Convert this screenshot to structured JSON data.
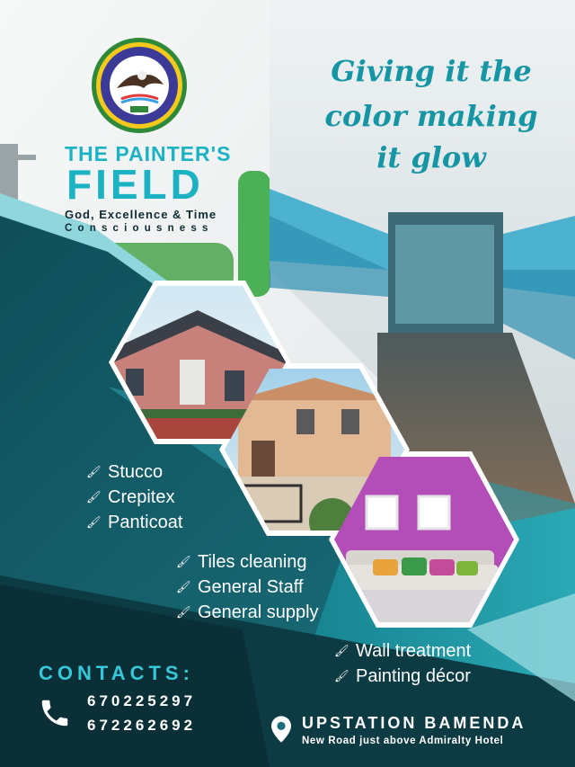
{
  "brand": {
    "logo_ring_text": "THE PAINTERS FIELD COMPANY LTD",
    "logo_motto_ring": "God, Excellence And Time Consciousness",
    "logo_badge": "MOTTO",
    "name_line1": "THE PAINTER'S",
    "name_line2": "FIELD",
    "motto_line1": "God, Excellence & Time",
    "motto_line2": "Consciousness"
  },
  "tagline": [
    "Giving it the",
    "color making",
    "it glow"
  ],
  "services": {
    "group1": [
      "Stucco",
      "Crepitex",
      "Panticoat"
    ],
    "group2": [
      "Tiles cleaning",
      "General Staff",
      "General supply"
    ],
    "group3": [
      "Wall treatment",
      "Painting décor"
    ]
  },
  "contacts": {
    "title": "CONTACTS:",
    "phones": [
      "670225297",
      "672262692"
    ],
    "location": "UPSTATION BAMENDA",
    "address": "New Road just above Admiralty Hotel"
  },
  "colors": {
    "brand_teal": "#1bb3c4",
    "dark_teal": "#0b3f4a",
    "light_cyan": "#8fd6dd",
    "accent_green": "#3aa845",
    "room_magenta": "#b34db8"
  },
  "icons": [
    "paint-brush-icon",
    "phone-icon",
    "location-pin-icon"
  ]
}
